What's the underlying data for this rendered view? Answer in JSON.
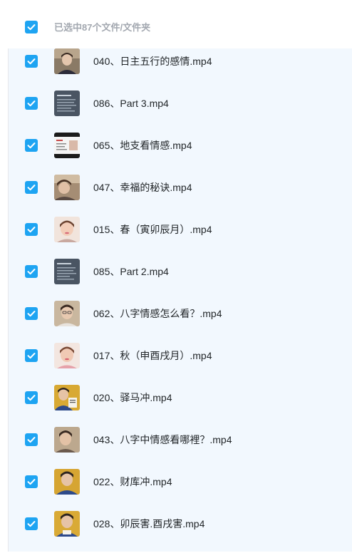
{
  "header": {
    "selection_label": "已选中87个文件/文件夹",
    "checked": true
  },
  "colors": {
    "accent": "#1ea4f2",
    "selected_row_bg": "#f2f8fe",
    "header_text": "#a3a8b0",
    "file_text": "#222629"
  },
  "files": [
    {
      "name": "040、日主五行的感情.mp4",
      "checked": true,
      "thumb": "video-thumbnail-person"
    },
    {
      "name": "086、Part 3.mp4",
      "checked": true,
      "thumb": "video-thumbnail-slide"
    },
    {
      "name": "065、地支看情感.mp4",
      "checked": true,
      "thumb": "video-thumbnail-document"
    },
    {
      "name": "047、幸福的秘诀.mp4",
      "checked": true,
      "thumb": "video-thumbnail-person"
    },
    {
      "name": "015、春（寅卯辰月）.mp4",
      "checked": true,
      "thumb": "video-thumbnail-person"
    },
    {
      "name": "085、Part 2.mp4",
      "checked": true,
      "thumb": "video-thumbnail-slide"
    },
    {
      "name": "062、八字情感怎么看？.mp4",
      "checked": true,
      "thumb": "video-thumbnail-person"
    },
    {
      "name": "017、秋（申酉戌月）.mp4",
      "checked": true,
      "thumb": "video-thumbnail-person"
    },
    {
      "name": "020、驿马冲.mp4",
      "checked": true,
      "thumb": "video-thumbnail-person"
    },
    {
      "name": "043、八字中情感看哪裡？.mp4",
      "checked": true,
      "thumb": "video-thumbnail-person"
    },
    {
      "name": "022、财库冲.mp4",
      "checked": true,
      "thumb": "video-thumbnail-person"
    },
    {
      "name": "028、卯辰害.酉戌害.mp4",
      "checked": true,
      "thumb": "video-thumbnail-person"
    }
  ]
}
